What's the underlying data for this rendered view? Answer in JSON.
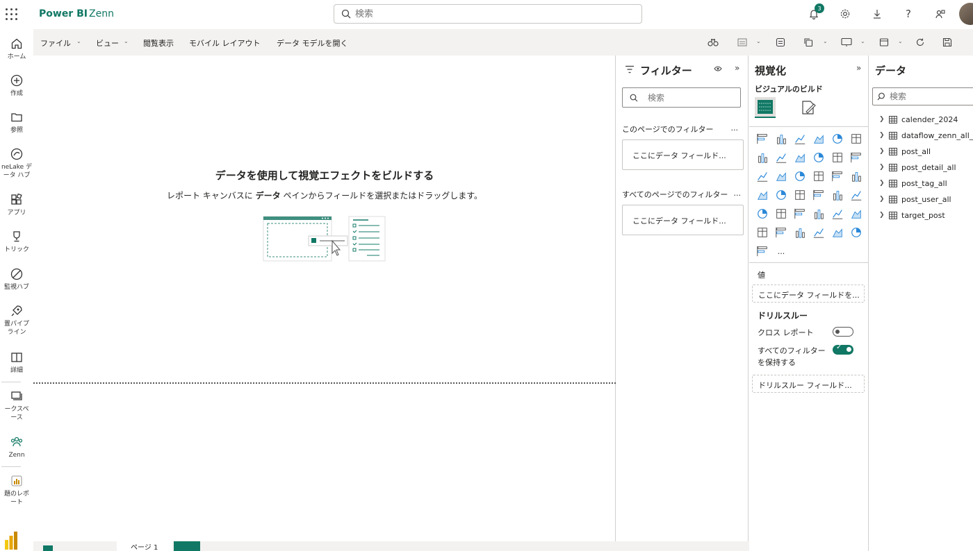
{
  "header": {
    "brand": "Power BI",
    "workspace": "Zenn",
    "search_placeholder": "検索",
    "notification_count": "3"
  },
  "leftnav": [
    {
      "name": "home",
      "label": "ホーム"
    },
    {
      "name": "create",
      "label": "作成"
    },
    {
      "name": "browse",
      "label": "参照"
    },
    {
      "name": "onelake",
      "label": "neLake デ\nータ ハブ"
    },
    {
      "name": "apps",
      "label": "アプリ"
    },
    {
      "name": "metrics",
      "label": "トリック"
    },
    {
      "name": "monitor",
      "label": "監視ハブ"
    },
    {
      "name": "pipelines",
      "label": "置パイプ\nライン"
    },
    {
      "name": "learn",
      "label": "詳細"
    },
    {
      "name": "workspaces",
      "label": "ークスペ\nース"
    },
    {
      "name": "zenn",
      "label": "Zenn"
    },
    {
      "name": "report",
      "label": "題のレポ\nート"
    }
  ],
  "ribbon": {
    "file": "ファイル",
    "view": "ビュー",
    "reading": "閲覧表示",
    "mobile": "モバイル レイアウト",
    "model": "データ モデルを開く"
  },
  "canvas": {
    "title": "データを使用して視覚エフェクトをビルドする",
    "sub_prefix": "レポート キャンバスに ",
    "sub_bold": "データ",
    "sub_suffix": " ペインからフィールドを選択またはドラッグします。"
  },
  "pages": {
    "tab_label": "ページ 1"
  },
  "filters": {
    "title": "フィルター",
    "search_placeholder": "検索",
    "page_section": "このページでのフィルター",
    "all_section": "すべてのページでのフィルター",
    "more": "...",
    "drop_here": "ここにデータ フィールド..."
  },
  "viz": {
    "title": "視覚化",
    "build": "ビジュアルのビルド",
    "values_label": "値",
    "values_well": "ここにデータ フィールドを...",
    "drill_title": "ドリルスルー",
    "cross_report": "クロス レポート",
    "keep_filters": "すべてのフィルター\nを保持する",
    "drill_well": "ドリルスルー フィールド...",
    "more_visuals": "..."
  },
  "data": {
    "title": "データ",
    "search_placeholder": "検索",
    "tables": [
      "calender_2024",
      "dataflow_zenn_all_us",
      "post_all",
      "post_detail_all",
      "post_tag_all",
      "post_user_all",
      "target_post"
    ]
  },
  "colors": {
    "accent": "#117865",
    "ribbon_bg": "#f3f2f1"
  }
}
